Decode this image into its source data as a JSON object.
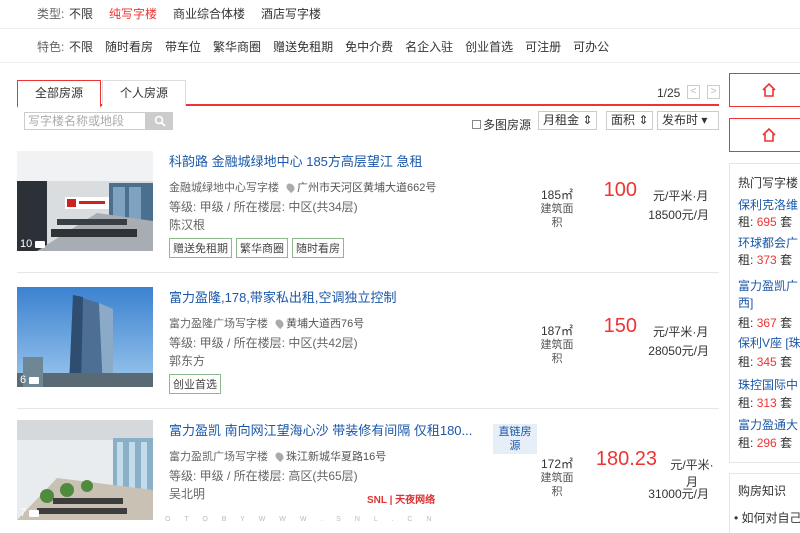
{
  "filters": {
    "type_label": "类型:",
    "types": [
      {
        "label": "不限",
        "active": false
      },
      {
        "label": "纯写字楼",
        "active": true
      },
      {
        "label": "商业综合体楼",
        "active": false
      },
      {
        "label": "酒店写字楼",
        "active": false
      }
    ],
    "feature_label": "特色:",
    "features": [
      "不限",
      "随时看房",
      "带车位",
      "繁华商圈",
      "赠送免租期",
      "免中介费",
      "名企入驻",
      "创业首选",
      "可注册",
      "可办公"
    ]
  },
  "tabs": {
    "all": "全部房源",
    "personal": "个人房源"
  },
  "pager": {
    "text": "1/25",
    "prev": "<",
    "next": ">"
  },
  "toolbar": {
    "search_placeholder": "写字楼名称或地段",
    "multi_image": "多图房源",
    "sort_rent": "月租金",
    "sort_area": "面积",
    "sort_time": "发布时"
  },
  "listings": [
    {
      "title": "科韵路 金融城绿地中心 185方高层望江 急租",
      "building": "金融城绿地中心写字楼",
      "address": "广州市天河区黄埔大道662号",
      "info": "等级:  甲级   /   所在楼层:  中区(共34层)",
      "agent": "陈汉根",
      "tags": [
        "赠送免租期",
        "繁华商圈",
        "随时看房"
      ],
      "img_count": "10",
      "area_num": "185㎡",
      "area_label": "建筑面积",
      "price": "100",
      "unit": "元/平米·月",
      "total": "18500元/月",
      "direct": ""
    },
    {
      "title": "富力盈隆,178,带家私出租,空调独立控制",
      "building": "富力盈隆广场写字楼",
      "address": "黄埔大道西76号",
      "info": "等级:  甲级   /   所在楼层:  中区(共42层)",
      "agent": "郭东方",
      "tags": [
        "创业首选"
      ],
      "img_count": "6",
      "area_num": "187㎡",
      "area_label": "建筑面积",
      "price": "150",
      "unit": "元/平米·月",
      "total": "28050元/月",
      "direct": ""
    },
    {
      "title": "富力盈凯 南向网江望海心沙 带装修有间隔 仅租180...",
      "building": "富力盈凯广场写字楼",
      "address": "珠江新城华夏路16号",
      "info": "等级:  甲级   /   所在楼层:  高区(共65层)",
      "agent": "吴北明",
      "tags": [],
      "img_count": "7",
      "area_num": "172㎡",
      "area_label": "建筑面积",
      "price": "180.23",
      "unit": "元/平米·月",
      "total": "31000元/月",
      "direct": "直链房源"
    }
  ],
  "sidebar": {
    "hot_title": "热门写字楼",
    "items": [
      {
        "name": "保利克洛维",
        "rent_label": "租:",
        "rent": "695",
        "suffix": "套"
      },
      {
        "name": "环球都会广",
        "rent_label": "租:",
        "rent": "373",
        "suffix": "套"
      },
      {
        "name": "富力盈凯广",
        "extra": "西]",
        "rent_label": "租:",
        "rent": "367",
        "suffix": "套"
      },
      {
        "name": "保利V座 [珠",
        "rent_label": "租:",
        "rent": "345",
        "suffix": "套"
      },
      {
        "name": "珠控国际中",
        "rent_label": "租:",
        "rent": "313",
        "suffix": "套"
      },
      {
        "name": "富力盈通大",
        "rent_label": "租:",
        "rent": "296",
        "suffix": "套"
      }
    ],
    "knowledge_title": "购房知识",
    "knowledge_item": "如何对自己"
  },
  "watermark": {
    "logo": "SNL | 天夜网络",
    "line": "O T O B Y W W W . S N L . C N"
  },
  "colors": {
    "accent": "#e33",
    "link": "#1a57a8",
    "tag_border": "#8cba8c"
  }
}
